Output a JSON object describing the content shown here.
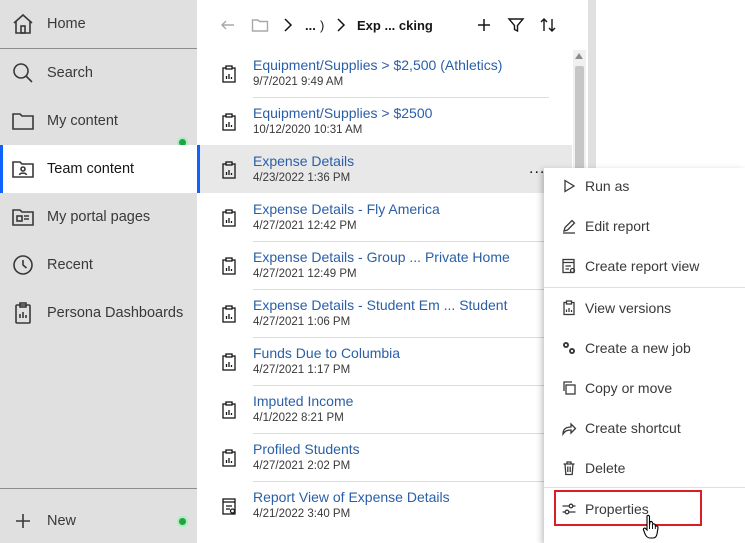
{
  "sidebar": {
    "items": [
      {
        "label": "Home",
        "icon": "home-icon"
      },
      {
        "label": "Search",
        "icon": "search-icon"
      },
      {
        "label": "My content",
        "icon": "folder-icon"
      },
      {
        "label": "Team content",
        "icon": "team-folder-icon"
      },
      {
        "label": "My portal pages",
        "icon": "portal-pages-icon"
      },
      {
        "label": "Recent",
        "icon": "clock-icon"
      },
      {
        "label": "Persona Dashboards",
        "icon": "clipboard-icon"
      }
    ],
    "new_label": "New",
    "active_index": 3
  },
  "toolbar": {
    "ellipsis": "...",
    "close_paren": ")",
    "current_folder": "Exp ... cking",
    "add_icon": "add-icon",
    "filter_icon": "filter-icon",
    "sort_icon": "sort-icon"
  },
  "reports": [
    {
      "name": "Equipment/Supplies > $2,500 (Athletics)",
      "date": "9/7/2021 9:49 AM"
    },
    {
      "name": "Equipment/Supplies > $2500",
      "date": "10/12/2020 10:31 AM"
    },
    {
      "name": "Expense Details",
      "date": "4/23/2022 1:36 PM"
    },
    {
      "name": "Expense Details - Fly America",
      "date": "4/27/2021 12:42 PM"
    },
    {
      "name": "Expense Details - Group ... Private Home",
      "date": "4/27/2021 12:49 PM"
    },
    {
      "name": "Expense Details - Student Em ... Student",
      "date": "4/27/2021 1:06 PM"
    },
    {
      "name": "Funds Due to Columbia",
      "date": "4/27/2021 1:17 PM"
    },
    {
      "name": "Imputed Income",
      "date": "4/1/2022 8:21 PM"
    },
    {
      "name": "Profiled Students",
      "date": "4/27/2021 2:02 PM"
    },
    {
      "name": "Report View of Expense Details",
      "date": "4/21/2022 3:40 PM"
    }
  ],
  "selected_report_index": 2,
  "row_menu_label": "...",
  "context_menu": {
    "items": [
      {
        "label": "Run as",
        "icon": "play-icon"
      },
      {
        "label": "Edit report",
        "icon": "edit-icon"
      },
      {
        "label": "Create report view",
        "icon": "report-view-icon"
      },
      {
        "label": "View versions",
        "icon": "versions-icon"
      },
      {
        "label": "Create a new job",
        "icon": "gears-icon"
      },
      {
        "label": "Copy or move",
        "icon": "copy-icon"
      },
      {
        "label": "Create shortcut",
        "icon": "shortcut-icon"
      },
      {
        "label": "Delete",
        "icon": "trash-icon"
      },
      {
        "label": "Properties",
        "icon": "sliders-icon"
      }
    ],
    "highlighted_index": 8
  },
  "colors": {
    "accent": "#0f62fe",
    "link": "#2a5fa8",
    "highlight": "#da1e28",
    "badge": "#24a148"
  }
}
